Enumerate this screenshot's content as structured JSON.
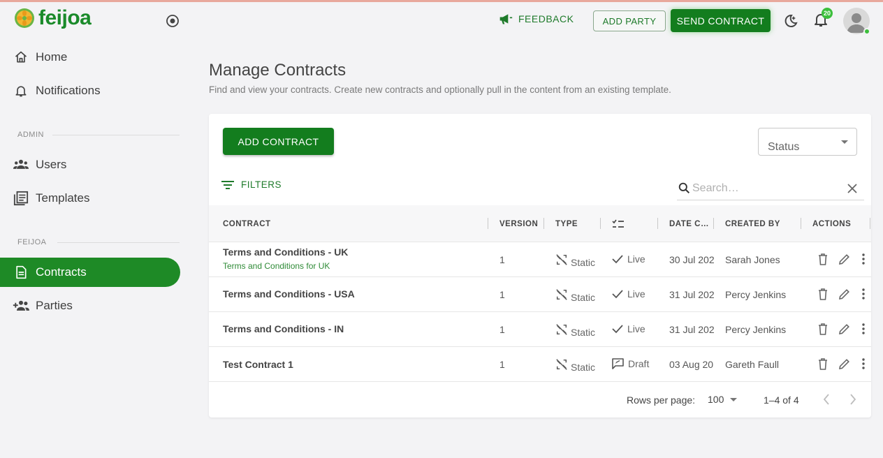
{
  "app": {
    "name": "feijoa",
    "brand_color": "#1e8a26"
  },
  "sidebar": {
    "items_top": [
      {
        "label": "Home",
        "icon": "home-icon"
      },
      {
        "label": "Notifications",
        "icon": "bell-icon"
      }
    ],
    "section_admin": "ADMIN",
    "items_admin": [
      {
        "label": "Users",
        "icon": "users-icon"
      },
      {
        "label": "Templates",
        "icon": "templates-icon"
      }
    ],
    "section_feijoa": "FEIJOA",
    "items_feijoa": [
      {
        "label": "Contracts",
        "icon": "document-icon",
        "active": true
      },
      {
        "label": "Parties",
        "icon": "add-group-icon"
      }
    ]
  },
  "topbar": {
    "feedback": "FEEDBACK",
    "add_party": "ADD PARTY",
    "send_contract": "SEND CONTRACT",
    "notification_count": "20"
  },
  "page": {
    "title": "Manage Contracts",
    "subtitle": "Find and view your contracts. Create new contracts and optionally pull in the content from an existing template."
  },
  "toolbar": {
    "add_contract": "ADD CONTRACT",
    "status_placeholder": "Status",
    "filters": "FILTERS",
    "search_placeholder": "Search…"
  },
  "table": {
    "columns": {
      "contract": "CONTRACT",
      "version": "VERSION",
      "type": "TYPE",
      "date": "DATE C…",
      "created_by": "CREATED BY",
      "actions": "ACTIONS"
    },
    "rows": [
      {
        "name": "Terms and Conditions - UK",
        "description": "Terms and Conditions for UK",
        "version": "1",
        "type": "Static",
        "status": "Live",
        "date": "30 Jul 202",
        "created_by": "Sarah Jones"
      },
      {
        "name": "Terms and Conditions - USA",
        "description": "",
        "version": "1",
        "type": "Static",
        "status": "Live",
        "date": "31 Jul 202",
        "created_by": "Percy Jenkins"
      },
      {
        "name": "Terms and Conditions - IN",
        "description": "",
        "version": "1",
        "type": "Static",
        "status": "Live",
        "date": "31 Jul 202",
        "created_by": "Percy Jenkins"
      },
      {
        "name": "Test Contract 1",
        "description": "",
        "version": "1",
        "type": "Static",
        "status": "Draft",
        "date": "03 Aug 20",
        "created_by": "Gareth Faull"
      }
    ]
  },
  "pagination": {
    "rows_per_page_label": "Rows per page:",
    "rows_per_page": "100",
    "range": "1–4 of 4"
  }
}
